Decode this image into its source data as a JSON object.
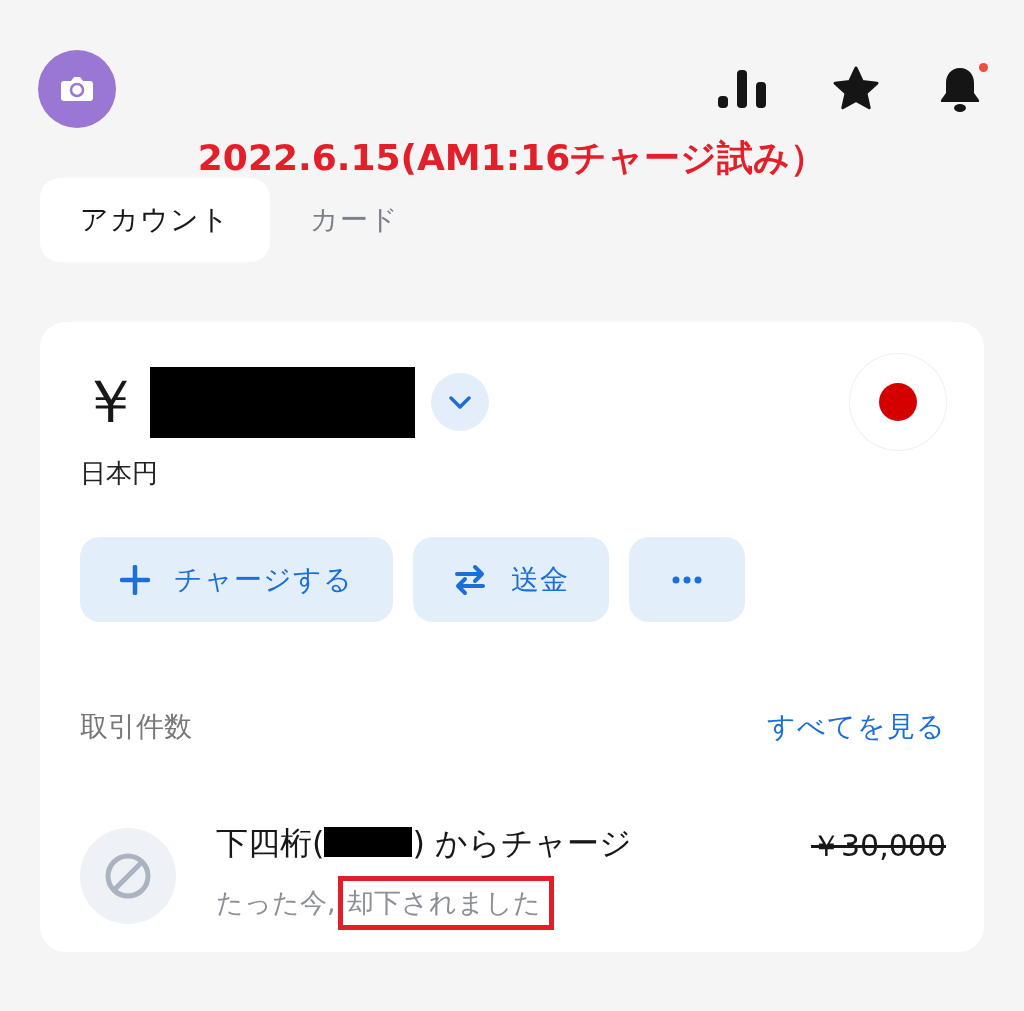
{
  "header": {
    "notification_badge": true
  },
  "annotation": "2022.6.15(AM1:16チャージ試み）",
  "tabs": [
    {
      "label": "アカウント",
      "selected": true
    },
    {
      "label": "カード",
      "selected": false
    }
  ],
  "account": {
    "currency_symbol": "￥",
    "currency_name": "日本円",
    "actions": [
      {
        "kind": "charge",
        "label": "チャージする"
      },
      {
        "kind": "transfer",
        "label": "送金"
      },
      {
        "kind": "more"
      }
    ]
  },
  "transactions": {
    "title": "取引件数",
    "see_all": "すべてを見る",
    "items": [
      {
        "title_before": "下四桁(",
        "title_after": ") からチャージ",
        "amount": "￥30,000",
        "declined": true,
        "time": "たった今,",
        "status": "却下されました",
        "highlighted": true
      }
    ]
  }
}
